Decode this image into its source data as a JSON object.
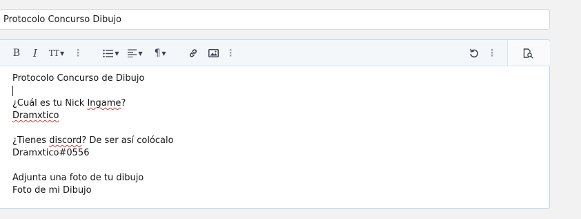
{
  "title_input": {
    "value": "Protocolo Concurso Dibujo"
  },
  "toolbar": {
    "icons": {
      "bold": "B",
      "italic": "I",
      "text_size": "TT",
      "list": "list-icon",
      "align": "align-icon",
      "paragraph": "¶",
      "link": "link-icon",
      "image": "image-icon",
      "undo": "undo-icon",
      "preview": "preview-icon"
    }
  },
  "editor": {
    "lines": {
      "l1": "Protocolo Concurso de Dibujo",
      "l3": "¿Cuál es tu Nick ",
      "l3_spell": "Ingame",
      "l3_end": "?",
      "l4_spell": "Dramxtico",
      "l6a": "¿Tienes ",
      "l6_spell": "discord",
      "l6b": "? De ser así colócalo",
      "l7": "Dramxtico#0556",
      "l9": "Adjunta una foto de tu dibujo",
      "l10": "Foto de mi Dibujo"
    }
  }
}
